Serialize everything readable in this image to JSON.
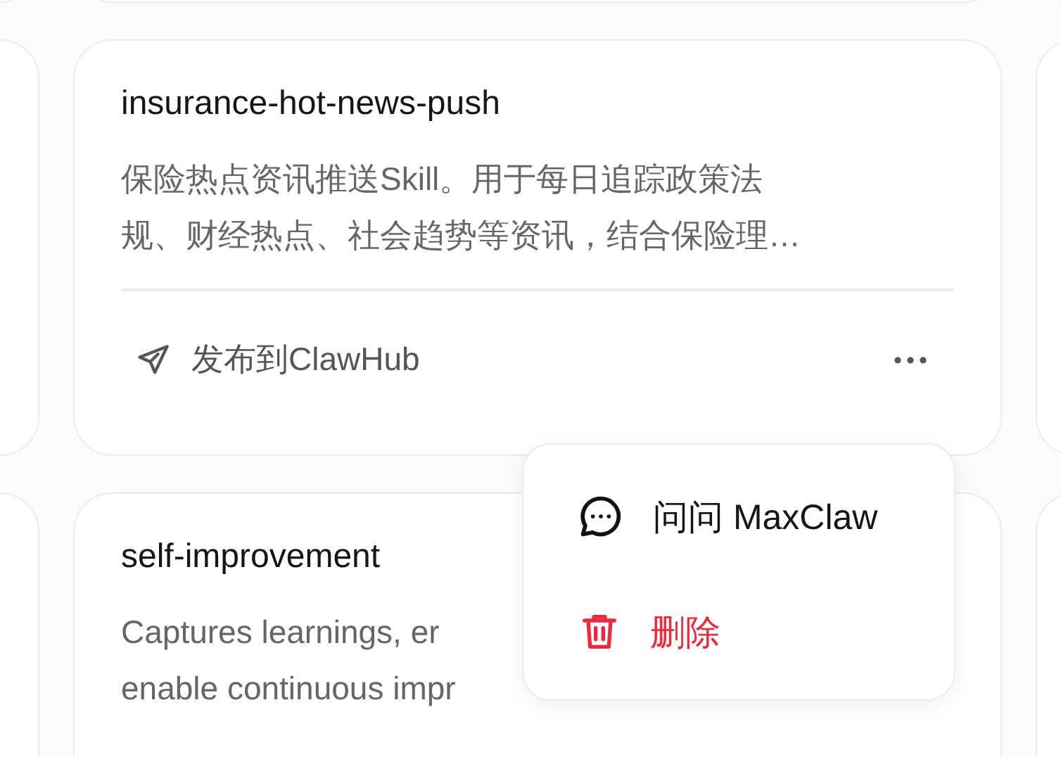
{
  "cards": [
    {
      "title": "insurance-hot-news-push",
      "description": [
        "保险热点资讯推送Skill。用于每日追踪政策法",
        "规、财经热点、社会趋势等资讯，结合保险理…"
      ],
      "publish_label": "发布到ClawHub"
    },
    {
      "title": "self-improvement",
      "description": [
        "Captures learnings, er",
        "enable continuous impr"
      ]
    }
  ],
  "menu": {
    "items": [
      {
        "kind": "ask",
        "label": "问问 MaxClaw"
      },
      {
        "kind": "delete",
        "label": "删除"
      }
    ]
  }
}
